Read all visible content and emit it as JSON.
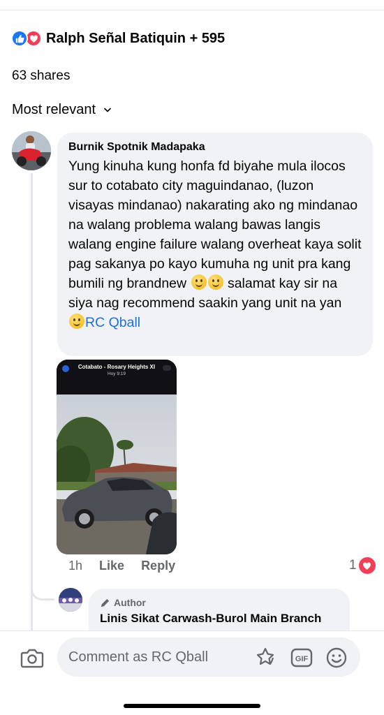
{
  "reactions": {
    "icons": [
      "like-icon",
      "love-icon"
    ],
    "summary": "Ralph Señal Batiquin + 595",
    "colors": {
      "like": "#1877f2",
      "love": "#f33e58"
    }
  },
  "shares": "63 shares",
  "sort": {
    "label": "Most relevant",
    "icon": "chevron-down-icon"
  },
  "comment": {
    "author": "Burnik Spotnik Madapaka",
    "text_part1": "Yung kinuha kung honfa fd biyahe mula ilocos sur to cotabato city maguindanao, (luzon visayas mindanao) nakarating ako ng mindanao na walang problema walang bawas langis walang engine failure walang overheat kaya solit pag sakanya po kayo kumuha ng unit  pra kang bumili ng brandnew",
    "text_part2": " salamat kay sir na siya nag recommend saakin yang unit na yan",
    "mention": "RC Qball",
    "attachment": {
      "chat_title": "Cotabato - Rosary Heights XI",
      "chat_subtitle": "Hoy  9:19"
    },
    "time": "1h",
    "like_label": "Like",
    "reply_label": "Reply",
    "reaction_count": "1"
  },
  "reply": {
    "badge": "Author",
    "author": "Linis Sikat Carwash-Burol Main Branch"
  },
  "composer": {
    "placeholder": "Comment as RC Qball",
    "icons": [
      "camera-icon",
      "sticker-icon",
      "gif-icon",
      "emoji-icon"
    ],
    "gif_label": "GIF"
  }
}
